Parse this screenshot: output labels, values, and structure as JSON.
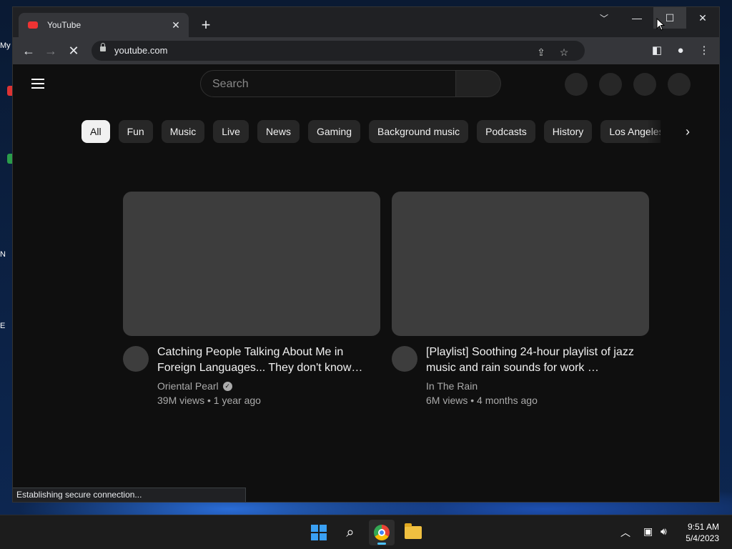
{
  "desktop": {
    "icon_labels": [
      "My",
      "N",
      "E"
    ]
  },
  "browser": {
    "tab": {
      "title": "YouTube",
      "favicon": "youtube-icon"
    },
    "url": "youtube.com",
    "status": "Establishing secure connection..."
  },
  "youtube": {
    "search_placeholder": "Search",
    "chips": [
      "All",
      "Fun",
      "Music",
      "Live",
      "News",
      "Gaming",
      "Background music",
      "Podcasts",
      "History",
      "Los Angeles"
    ],
    "active_chip": "All",
    "videos": [
      {
        "title": "Catching People Talking About Me in Foreign Languages... They don't know…",
        "channel": "Oriental Pearl",
        "verified": true,
        "stats": "39M views • 1 year ago"
      },
      {
        "title": "[Playlist] Soothing 24-hour playlist of jazz music and rain sounds for work …",
        "channel": "In The Rain",
        "verified": false,
        "stats": "6M views • 4 months ago"
      }
    ]
  },
  "taskbar": {
    "time": "9:51 AM",
    "date": "5/4/2023"
  },
  "colors": {
    "page_bg": "#0f0f0f",
    "chip_bg": "#272727",
    "chip_active_bg": "#f1f1f1",
    "placeholder": "#3d3d3d",
    "tab_bg": "#35363a",
    "accent": "#4cc2ff"
  }
}
